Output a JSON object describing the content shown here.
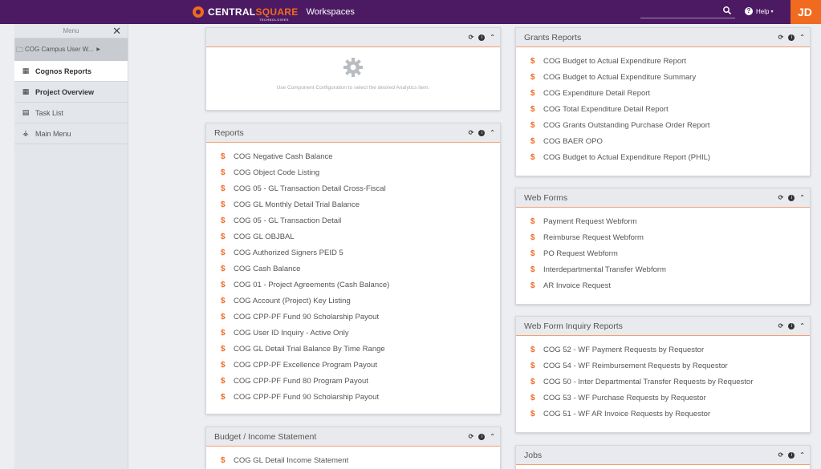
{
  "header": {
    "brand_prefix": "CENTRAL",
    "brand_suffix": "SQUARE",
    "brand_sub": "TECHNOLOGIES",
    "app_title": "Workspaces",
    "help_label": "Help",
    "user_initials": "JD",
    "colors": {
      "bar": "#4b1a63",
      "accent": "#f06b1f"
    }
  },
  "sidebar": {
    "title": "Menu",
    "workspace": "COG Campus User W...",
    "items": [
      {
        "label": "Cognos Reports",
        "icon": "grid-icon"
      },
      {
        "label": "Project Overview",
        "icon": "grid-icon"
      },
      {
        "label": "Task List",
        "icon": "calendar-icon"
      },
      {
        "label": "Main Menu",
        "icon": "sitemap-icon"
      }
    ]
  },
  "analytics": {
    "message": "Use Component Configuration to select the desired Analytics item."
  },
  "reports": {
    "title": "Reports",
    "items": [
      "COG Negative Cash Balance",
      "COG Object Code Listing",
      "COG 05 - GL Transaction Detail Cross-Fiscal",
      "COG GL Monthly Detail Trial Balance",
      "COG 05 - GL Transaction Detail",
      "COG GL OBJBAL",
      "COG Authorized Signers PEID 5",
      "COG Cash Balance",
      "COG 01 - Project Agreements (Cash Balance)",
      "COG Account (Project) Key Listing",
      "COG CPP-PF Fund 90 Scholarship Payout",
      "COG User ID Inquiry - Active Only",
      "COG GL Detail Trial Balance By Time Range",
      "COG CPP-PF Excellence Program Payout",
      "COG CPP-PF Fund 80 Program Payout",
      "COG CPP-PF Fund 90 Scholarship Payout"
    ]
  },
  "budget": {
    "title": "Budget / Income Statement",
    "items": [
      "COG GL Detail Income Statement"
    ]
  },
  "grants": {
    "title": "Grants Reports",
    "items": [
      "COG Budget to Actual Expenditure Report",
      "COG Budget to Actual Expenditure Summary",
      "COG Expenditure Detail Report",
      "COG Total Expenditure Detail Report",
      "COG Grants Outstanding Purchase Order Report",
      "COG BAER OPO",
      "COG Budget to Actual Expenditure Report (PHIL)"
    ]
  },
  "webforms": {
    "title": "Web Forms",
    "items": [
      "Payment Request Webform",
      "Reimburse Request Webform",
      "PO Request Webform",
      "Interdepartmental Transfer Webform",
      "AR Invoice Request"
    ]
  },
  "inquiry": {
    "title": "Web Form Inquiry Reports",
    "items": [
      "COG 52 - WF Payment Requests by Requestor",
      "COG 54 - WF Reimbursement Requests by Requestor",
      "COG 50 - Inter Departmental Transfer Requests by Requestor",
      "COG 53 - WF Purchase Requests by Requestor",
      "COG 51 - WF AR Invoice Requests by Requestor"
    ]
  },
  "jobs": {
    "title": "Jobs"
  }
}
